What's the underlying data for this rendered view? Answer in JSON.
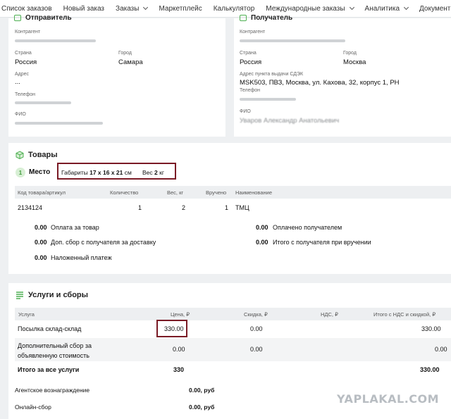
{
  "nav": {
    "items": [
      {
        "label": "Список заказов",
        "dropdown": false
      },
      {
        "label": "Новый заказ",
        "dropdown": false
      },
      {
        "label": "Заказы",
        "dropdown": true
      },
      {
        "label": "Маркетплейс",
        "dropdown": false
      },
      {
        "label": "Калькулятор",
        "dropdown": false
      },
      {
        "label": "Международные заказы",
        "dropdown": true
      },
      {
        "label": "Аналитика",
        "dropdown": true
      },
      {
        "label": "Документы",
        "dropdown": false
      }
    ]
  },
  "sender": {
    "title": "Отправитель",
    "contractor_label": "Контрагент",
    "country_label": "Страна",
    "country": "Россия",
    "city_label": "Город",
    "city": "Самара",
    "address_label": "Адрес",
    "address": "...",
    "phone_label": "Телефон",
    "name_label": "ФИО"
  },
  "recipient": {
    "title": "Получатель",
    "contractor_label": "Контрагент",
    "country_label": "Страна",
    "country": "Россия",
    "city_label": "Город",
    "city": "Москва",
    "pickup_label": "Адрес пункта выдачи СДЭК",
    "pickup": "MSK503, ПВЗ, Москва, ул. Кахова, 32, корпус 1, РН",
    "phone_label": "Телефон",
    "name_label": "ФИО",
    "name": "Уваров Александр Анатольевич"
  },
  "goods": {
    "title": "Товары",
    "place_number": "1",
    "place_label": "Место",
    "dims_label": "Габариты",
    "dims_value": "17 x 16 x 21",
    "dims_unit": "см",
    "weight_label": "Вес",
    "weight_value": "2",
    "weight_unit": "кг",
    "columns": [
      "Код товара/артикул",
      "Количество",
      "Вес, кг",
      "Вручено",
      "Наименование"
    ],
    "row": {
      "code": "2134124",
      "qty": "1",
      "weight": "2",
      "delivered": "1",
      "name": "ТМЦ"
    },
    "payments_left": [
      {
        "value": "0.00",
        "label": "Оплата за товар"
      },
      {
        "value": "0.00",
        "label": "Доп. сбор с получателя за доставку"
      },
      {
        "value": "0.00",
        "label": "Наложенный платеж"
      }
    ],
    "payments_right": [
      {
        "value": "0.00",
        "label": "Оплачено получателем"
      },
      {
        "value": "0.00",
        "label": "Итого с получателя при вручении"
      }
    ]
  },
  "services": {
    "title": "Услуги и сборы",
    "columns": [
      "Услуга",
      "Цена, ₽",
      "Скидка, ₽",
      "НДС, ₽",
      "Итого с НДС и скидкой, ₽"
    ],
    "rows": [
      {
        "name": "Посылка склад-склад",
        "price": "330.00",
        "discount": "0.00",
        "vat": "",
        "total": "330.00"
      },
      {
        "name": "Дополнительный сбор за объявленную стоимость",
        "price": "0.00",
        "discount": "0.00",
        "vat": "",
        "total": "0.00"
      }
    ],
    "total_row": {
      "name": "Итого за все услуги",
      "price": "330",
      "total": "330.00"
    },
    "agent_label": "Агентское вознаграждение",
    "agent_value": "0.00, руб",
    "online_label": "Онлайн-сбор",
    "online_value": "0.00, руб"
  },
  "watermark": "YAPLAKAL.COM",
  "colors": {
    "accent_green": "#4caf50",
    "highlight_border": "#7a1a25"
  }
}
